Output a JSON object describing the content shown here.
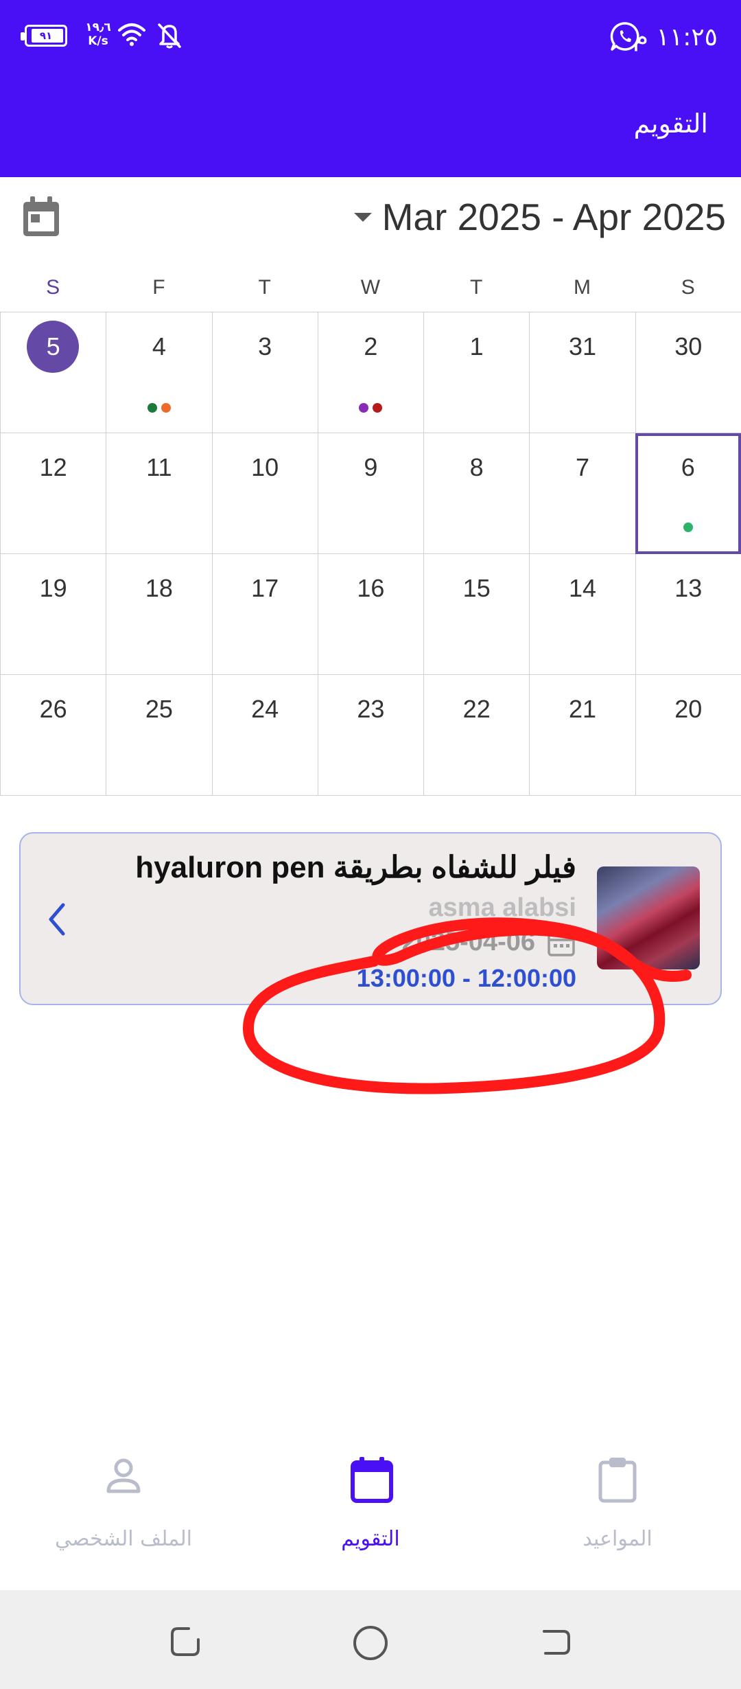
{
  "status_bar": {
    "time": "١١:٢٥ م",
    "battery_level": "٩١",
    "net_speed_value": "١٩٫٦",
    "net_speed_unit": "K/s"
  },
  "app_bar": {
    "title": "التقويم"
  },
  "calendar": {
    "month_range": "Mar 2025 - Apr 2025",
    "weekdays": [
      "S",
      "F",
      "T",
      "W",
      "T",
      "M",
      "S"
    ],
    "weeks": [
      [
        "5",
        "4",
        "3",
        "2",
        "1",
        "31",
        "30"
      ],
      [
        "12",
        "11",
        "10",
        "9",
        "8",
        "7",
        "6"
      ],
      [
        "19",
        "18",
        "17",
        "16",
        "15",
        "14",
        "13"
      ],
      [
        "26",
        "25",
        "24",
        "23",
        "22",
        "21",
        "20"
      ]
    ],
    "today": "5",
    "selected": "6"
  },
  "event": {
    "title": "فيلر للشفاه بطريقة hyaluron pen",
    "client_name": "asma alabsi",
    "date": "2025-04-06",
    "time_range": "13:00:00 - 12:00:00"
  },
  "bottom_nav": {
    "profile": "الملف الشخصي",
    "calendar": "التقويم",
    "appointments": "المواعيد"
  },
  "colors": {
    "primary": "#4a10f5",
    "today_circle": "#6549a6",
    "time_text": "#2e4fd0",
    "annotation": "#ff1a1a"
  }
}
